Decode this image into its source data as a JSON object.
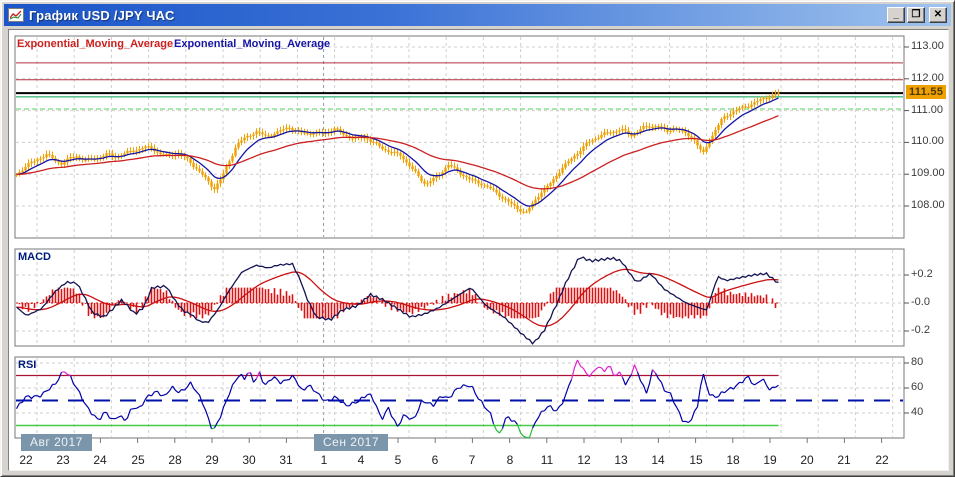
{
  "window": {
    "title": "График USD /JPY ЧАС",
    "minimize_label": "_",
    "maximize_label": "❒",
    "close_label": "✕"
  },
  "legend": {
    "items": [
      {
        "label": "Exponential_Moving_Average",
        "color": "#cc2020"
      },
      {
        "label": "Exponential_Moving_Average",
        "color": "#1515a3"
      }
    ]
  },
  "price_badge": {
    "value": "111.55"
  },
  "x_axis": {
    "months": [
      {
        "label": "Авг 2017",
        "day_index": 0
      },
      {
        "label": "Сен 2017",
        "day_index": 8
      }
    ],
    "days": [
      "22",
      "23",
      "24",
      "25",
      "28",
      "29",
      "30",
      "31",
      "1",
      "4",
      "5",
      "6",
      "7",
      "8",
      "11",
      "12",
      "13",
      "14",
      "15",
      "18",
      "19",
      "20",
      "21",
      "22"
    ]
  },
  "chart_data": [
    {
      "id": "price",
      "type": "candlestick",
      "title": "USD/JPY hourly candles with two exponential moving averages",
      "candle_color": "#f0a000",
      "data_end_frac": 0.859,
      "y_ticks": [
        {
          "v": 113,
          "label": "113.00"
        },
        {
          "v": 112,
          "label": "112.00"
        },
        {
          "v": 111,
          "label": "111.00"
        },
        {
          "v": 110,
          "label": "110.00"
        },
        {
          "v": 109,
          "label": "109.00"
        },
        {
          "v": 108,
          "label": "108.00"
        }
      ],
      "current_price": 111.55,
      "hlines": [
        {
          "value": 112.5,
          "color": "#b43040",
          "style": "solid",
          "width": 1,
          "full_width": true
        },
        {
          "value": 111.97,
          "color": "#b43040",
          "style": "solid",
          "width": 1,
          "full_width": true
        },
        {
          "value": 111.55,
          "color": "#000000",
          "style": "solid",
          "width": 2,
          "full_width": true
        },
        {
          "value": 111.43,
          "color": "#00a050",
          "style": "solid",
          "width": 1,
          "full_width": true
        },
        {
          "value": 111.05,
          "color": "#55d060",
          "style": "dashed",
          "width": 1,
          "full_width": true
        }
      ],
      "emas": [
        {
          "name": "Exponential_Moving_Average",
          "color": "#1515a3",
          "alpha": 0.2
        },
        {
          "name": "Exponential_Moving_Average",
          "color": "#cc2020",
          "alpha": 0.05
        }
      ],
      "close_points": [
        [
          0.0,
          108.95
        ],
        [
          0.012,
          109.25
        ],
        [
          0.024,
          109.45
        ],
        [
          0.035,
          109.62
        ],
        [
          0.046,
          109.42
        ],
        [
          0.052,
          109.33
        ],
        [
          0.062,
          109.5
        ],
        [
          0.069,
          109.58
        ],
        [
          0.08,
          109.42
        ],
        [
          0.09,
          109.5
        ],
        [
          0.103,
          109.62
        ],
        [
          0.115,
          109.55
        ],
        [
          0.13,
          109.72
        ],
        [
          0.145,
          109.83
        ],
        [
          0.153,
          109.85
        ],
        [
          0.163,
          109.63
        ],
        [
          0.173,
          109.58
        ],
        [
          0.183,
          109.67
        ],
        [
          0.195,
          109.45
        ],
        [
          0.205,
          109.15
        ],
        [
          0.217,
          108.78
        ],
        [
          0.224,
          108.55
        ],
        [
          0.232,
          108.85
        ],
        [
          0.24,
          109.35
        ],
        [
          0.249,
          109.9
        ],
        [
          0.26,
          110.18
        ],
        [
          0.271,
          110.33
        ],
        [
          0.282,
          110.2
        ],
        [
          0.295,
          110.3
        ],
        [
          0.308,
          110.5
        ],
        [
          0.318,
          110.32
        ],
        [
          0.33,
          110.28
        ],
        [
          0.348,
          110.3
        ],
        [
          0.36,
          110.42
        ],
        [
          0.368,
          110.28
        ],
        [
          0.38,
          110.12
        ],
        [
          0.393,
          110.18
        ],
        [
          0.405,
          109.95
        ],
        [
          0.42,
          109.72
        ],
        [
          0.434,
          109.6
        ],
        [
          0.447,
          109.15
        ],
        [
          0.462,
          108.68
        ],
        [
          0.475,
          108.92
        ],
        [
          0.487,
          109.3
        ],
        [
          0.497,
          109.12
        ],
        [
          0.51,
          108.85
        ],
        [
          0.525,
          108.7
        ],
        [
          0.54,
          108.45
        ],
        [
          0.556,
          108.1
        ],
        [
          0.568,
          107.88
        ],
        [
          0.575,
          107.78
        ],
        [
          0.583,
          108.1
        ],
        [
          0.592,
          108.45
        ],
        [
          0.6,
          108.62
        ],
        [
          0.614,
          109.15
        ],
        [
          0.63,
          109.6
        ],
        [
          0.645,
          110.0
        ],
        [
          0.658,
          110.22
        ],
        [
          0.67,
          110.32
        ],
        [
          0.682,
          110.42
        ],
        [
          0.693,
          110.2
        ],
        [
          0.705,
          110.45
        ],
        [
          0.716,
          110.5
        ],
        [
          0.723,
          110.55
        ],
        [
          0.733,
          110.32
        ],
        [
          0.742,
          110.48
        ],
        [
          0.752,
          110.3
        ],
        [
          0.763,
          110.15
        ],
        [
          0.77,
          109.8
        ],
        [
          0.774,
          109.62
        ],
        [
          0.78,
          110.0
        ],
        [
          0.787,
          110.35
        ],
        [
          0.796,
          110.75
        ],
        [
          0.806,
          110.95
        ],
        [
          0.815,
          111.05
        ],
        [
          0.824,
          111.15
        ],
        [
          0.834,
          111.28
        ],
        [
          0.843,
          111.38
        ],
        [
          0.852,
          111.48
        ],
        [
          0.859,
          111.55
        ]
      ]
    },
    {
      "id": "macd",
      "type": "line+histogram",
      "panel_label": "MACD",
      "macd_color": "#141452",
      "signal_color": "#cc1111",
      "signal_alpha": 0.09,
      "histogram_color": "#dd1111",
      "zero_line_color": "#cc1111",
      "y_ticks": [
        {
          "v": 0.2,
          "label": "+0.2"
        },
        {
          "v": 0.0,
          "label": "-0.0"
        },
        {
          "v": -0.2,
          "label": "-0.2"
        }
      ],
      "macd_points": [
        [
          0.0,
          -0.02
        ],
        [
          0.013,
          -0.09
        ],
        [
          0.03,
          -0.04
        ],
        [
          0.045,
          0.08
        ],
        [
          0.058,
          0.15
        ],
        [
          0.07,
          0.14
        ],
        [
          0.08,
          0.02
        ],
        [
          0.087,
          -0.07
        ],
        [
          0.1,
          -0.1
        ],
        [
          0.112,
          -0.03
        ],
        [
          0.12,
          0.02
        ],
        [
          0.128,
          -0.03
        ],
        [
          0.135,
          -0.08
        ],
        [
          0.145,
          -0.03
        ],
        [
          0.154,
          0.11
        ],
        [
          0.17,
          0.12
        ],
        [
          0.182,
          0.0
        ],
        [
          0.19,
          -0.06
        ],
        [
          0.198,
          -0.08
        ],
        [
          0.207,
          -0.13
        ],
        [
          0.217,
          -0.14
        ],
        [
          0.228,
          -0.05
        ],
        [
          0.24,
          0.08
        ],
        [
          0.255,
          0.22
        ],
        [
          0.271,
          0.27
        ],
        [
          0.285,
          0.25
        ],
        [
          0.295,
          0.27
        ],
        [
          0.312,
          0.28
        ],
        [
          0.322,
          0.15
        ],
        [
          0.327,
          0.05
        ],
        [
          0.339,
          -0.1
        ],
        [
          0.355,
          -0.12
        ],
        [
          0.368,
          -0.05
        ],
        [
          0.385,
          -0.02
        ],
        [
          0.4,
          0.06
        ],
        [
          0.415,
          0.02
        ],
        [
          0.43,
          -0.04
        ],
        [
          0.445,
          -0.1
        ],
        [
          0.46,
          -0.08
        ],
        [
          0.475,
          -0.04
        ],
        [
          0.49,
          0.02
        ],
        [
          0.505,
          0.08
        ],
        [
          0.513,
          0.11
        ],
        [
          0.53,
          -0.02
        ],
        [
          0.55,
          -0.1
        ],
        [
          0.57,
          -0.22
        ],
        [
          0.583,
          -0.29
        ],
        [
          0.595,
          -0.2
        ],
        [
          0.61,
          0.0
        ],
        [
          0.62,
          0.15
        ],
        [
          0.635,
          0.33
        ],
        [
          0.648,
          0.3
        ],
        [
          0.66,
          0.31
        ],
        [
          0.672,
          0.32
        ],
        [
          0.682,
          0.3
        ],
        [
          0.695,
          0.18
        ],
        [
          0.7,
          0.15
        ],
        [
          0.715,
          0.21
        ],
        [
          0.73,
          0.1
        ],
        [
          0.745,
          0.04
        ],
        [
          0.755,
          0.0
        ],
        [
          0.772,
          -0.04
        ],
        [
          0.778,
          -0.05
        ],
        [
          0.787,
          0.12
        ],
        [
          0.79,
          0.19
        ],
        [
          0.8,
          0.16
        ],
        [
          0.815,
          0.18
        ],
        [
          0.83,
          0.2
        ],
        [
          0.845,
          0.21
        ],
        [
          0.859,
          0.14
        ]
      ]
    },
    {
      "id": "rsi",
      "type": "line",
      "panel_label": "RSI",
      "line_color": "#0000a8",
      "y_ticks": [
        {
          "v": 80,
          "label": "80"
        },
        {
          "v": 60,
          "label": "60"
        },
        {
          "v": 40,
          "label": "40"
        }
      ],
      "overbought": {
        "level": 70,
        "line_color": "#aa1133",
        "seg_color": "#dd22cc"
      },
      "oversold": {
        "level": 30,
        "line_color": "#44cc44",
        "seg_color": "#22bb33"
      },
      "midline": {
        "level": 50,
        "color": "#0011aa",
        "style": "dashed"
      },
      "points": [
        [
          0.0,
          42
        ],
        [
          0.012,
          52
        ],
        [
          0.03,
          55
        ],
        [
          0.045,
          62
        ],
        [
          0.055,
          75
        ],
        [
          0.062,
          70
        ],
        [
          0.069,
          60
        ],
        [
          0.08,
          45
        ],
        [
          0.094,
          35
        ],
        [
          0.102,
          41
        ],
        [
          0.109,
          33
        ],
        [
          0.117,
          38
        ],
        [
          0.125,
          35
        ],
        [
          0.132,
          45
        ],
        [
          0.139,
          42
        ],
        [
          0.151,
          55
        ],
        [
          0.16,
          58
        ],
        [
          0.168,
          52
        ],
        [
          0.176,
          60
        ],
        [
          0.185,
          57
        ],
        [
          0.198,
          64
        ],
        [
          0.205,
          55
        ],
        [
          0.21,
          50
        ],
        [
          0.218,
          35
        ],
        [
          0.223,
          26
        ],
        [
          0.233,
          40
        ],
        [
          0.241,
          55
        ],
        [
          0.249,
          68
        ],
        [
          0.253,
          72
        ],
        [
          0.258,
          68
        ],
        [
          0.263,
          74
        ],
        [
          0.27,
          62
        ],
        [
          0.274,
          73
        ],
        [
          0.281,
          62
        ],
        [
          0.29,
          70
        ],
        [
          0.3,
          63
        ],
        [
          0.314,
          70
        ],
        [
          0.323,
          58
        ],
        [
          0.33,
          62
        ],
        [
          0.34,
          55
        ],
        [
          0.35,
          50
        ],
        [
          0.36,
          53
        ],
        [
          0.372,
          45
        ],
        [
          0.385,
          50
        ],
        [
          0.398,
          55
        ],
        [
          0.405,
          48
        ],
        [
          0.412,
          35
        ],
        [
          0.42,
          45
        ],
        [
          0.43,
          28
        ],
        [
          0.438,
          38
        ],
        [
          0.448,
          35
        ],
        [
          0.458,
          50
        ],
        [
          0.47,
          45
        ],
        [
          0.48,
          55
        ],
        [
          0.487,
          52
        ],
        [
          0.5,
          60
        ],
        [
          0.513,
          63
        ],
        [
          0.523,
          50
        ],
        [
          0.535,
          38
        ],
        [
          0.544,
          22
        ],
        [
          0.553,
          38
        ],
        [
          0.565,
          30
        ],
        [
          0.572,
          20
        ],
        [
          0.578,
          19
        ],
        [
          0.586,
          35
        ],
        [
          0.6,
          45
        ],
        [
          0.61,
          42
        ],
        [
          0.62,
          55
        ],
        [
          0.633,
          82
        ],
        [
          0.64,
          74
        ],
        [
          0.648,
          70
        ],
        [
          0.655,
          78
        ],
        [
          0.662,
          72
        ],
        [
          0.668,
          78
        ],
        [
          0.675,
          70
        ],
        [
          0.682,
          74
        ],
        [
          0.687,
          61
        ],
        [
          0.697,
          77
        ],
        [
          0.705,
          65
        ],
        [
          0.71,
          56
        ],
        [
          0.718,
          76
        ],
        [
          0.73,
          58
        ],
        [
          0.738,
          55
        ],
        [
          0.752,
          33
        ],
        [
          0.758,
          31
        ],
        [
          0.768,
          45
        ],
        [
          0.773,
          74
        ],
        [
          0.782,
          54
        ],
        [
          0.79,
          52
        ],
        [
          0.8,
          58
        ],
        [
          0.815,
          64
        ],
        [
          0.825,
          68
        ],
        [
          0.832,
          61
        ],
        [
          0.84,
          69
        ],
        [
          0.85,
          58
        ],
        [
          0.859,
          62
        ]
      ]
    }
  ]
}
